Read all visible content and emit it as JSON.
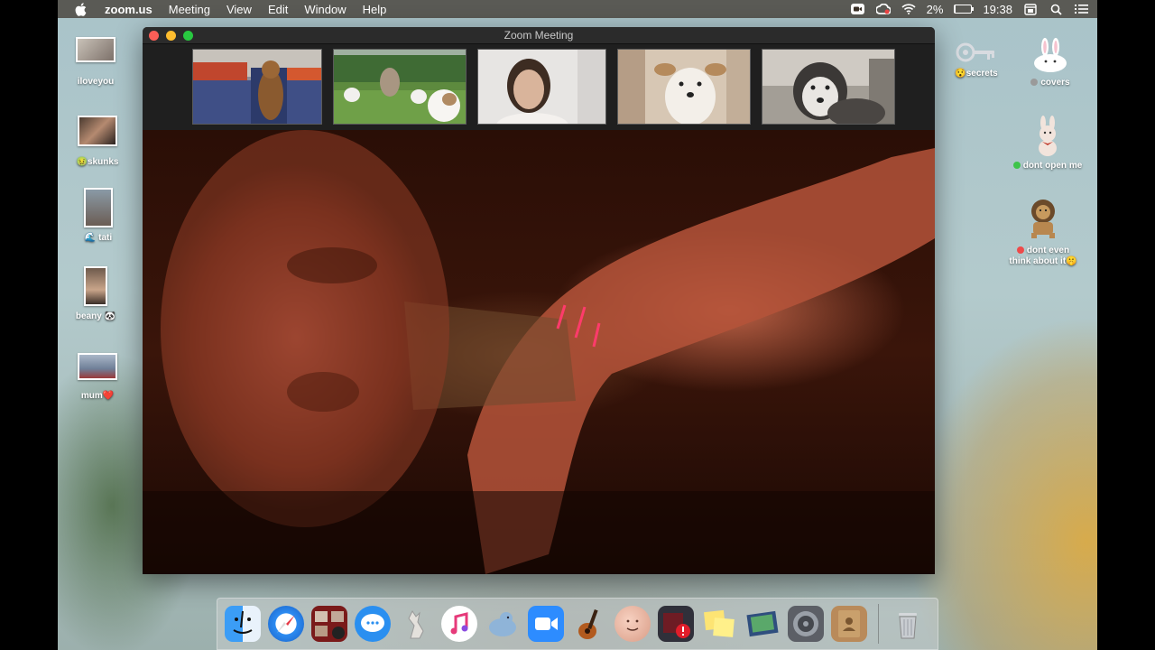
{
  "menubar": {
    "apple_icon": "apple-icon",
    "app_name": "zoom.us",
    "menus": [
      "Meeting",
      "View",
      "Edit",
      "Window",
      "Help"
    ],
    "battery_percent": "2%",
    "battery_level": 0.02,
    "time": "19:38",
    "status_icons": [
      "zoom-icon",
      "creative-cloud-icon",
      "wifi-icon",
      "battery-icon",
      "calendar-icon",
      "spotlight-search-icon",
      "list-icon"
    ]
  },
  "desktop_left": [
    {
      "label": "iloveyou",
      "dot": null
    },
    {
      "label": "skunks",
      "dot": "🤢"
    },
    {
      "label": "tati",
      "dot": "🌊"
    },
    {
      "label": "beany 🐼",
      "dot": null
    },
    {
      "label": "mum❤️",
      "dot": null
    }
  ],
  "desktop_right": [
    {
      "label": "secrets",
      "dot": "😯"
    },
    {
      "label": "covers",
      "dot_color": "#9a9a9a"
    },
    {
      "label": "dont open me",
      "dot_color": "#3ec44a"
    },
    {
      "label_line1": "dont even",
      "label_line2": "think about it",
      "emoji": "🤫",
      "dot_color": "#ee4a4a"
    }
  ],
  "window": {
    "title": "Zoom Meeting",
    "traffic_colors": {
      "close": "#fd5e57",
      "minimize": "#febc2e",
      "zoom": "#28c840"
    }
  },
  "participants": [
    {
      "subject": "dachshund-on-chair"
    },
    {
      "subject": "puppies-on-lawn"
    },
    {
      "subject": "woman-at-desk"
    },
    {
      "subject": "white-terrier"
    },
    {
      "subject": "husky"
    }
  ],
  "dock": {
    "items": [
      "finder-icon",
      "safari-icon",
      "photo-booth-icon",
      "messages-icon",
      "skype-kangaroo-icon",
      "itunes-icon",
      "sequel-pro-icon",
      "zoom-icon",
      "garageband-icon",
      "face-app-icon",
      "red-app-icon",
      "stickies-icon",
      "preview-icon",
      "system-preferences-icon",
      "contacts-icon"
    ],
    "trash": "trash-icon"
  }
}
